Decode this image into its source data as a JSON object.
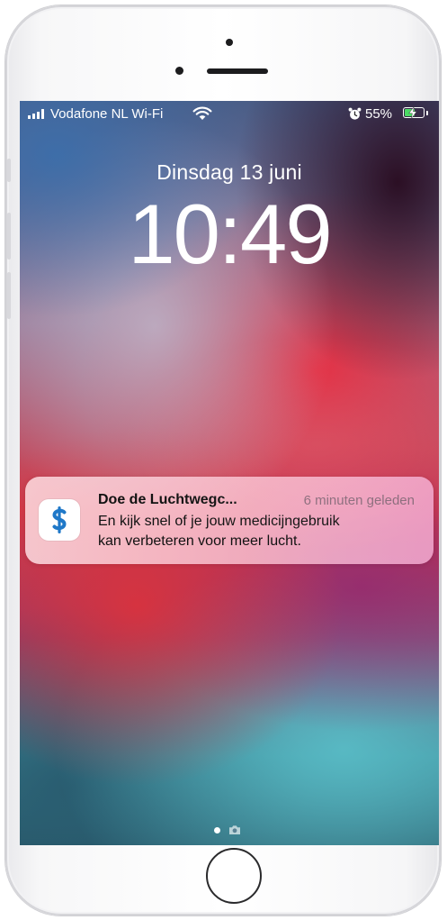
{
  "status_bar": {
    "carrier": "Vodafone NL Wi-Fi",
    "wifi_icon": "wifi-icon",
    "alarm_icon": "alarm-icon",
    "battery_percent": "55%",
    "battery_level": 0.55,
    "battery_charging": true
  },
  "lock_screen": {
    "date": "Dinsdag 13 juni",
    "time": "10:49"
  },
  "notification": {
    "app_icon": "app-logo-icon",
    "title": "Doe de Luchtwegc...",
    "time_ago": "6 minuten geleden",
    "body_line_1": "En kijk snel of je jouw medicijngebruik",
    "body_line_2": "kan verbeteren voor meer lucht."
  },
  "page_indicator": {
    "current_page_icon": "page-dot-icon",
    "camera_icon": "camera-icon"
  },
  "colors": {
    "accent_blue": "#1f78c8",
    "battery_green": "#4cd964",
    "notification_tint": "#f9c6d6"
  }
}
